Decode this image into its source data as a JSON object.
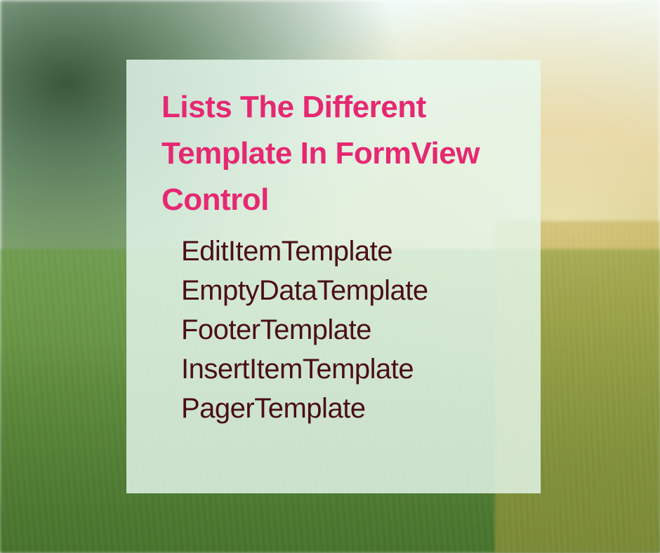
{
  "title": "Lists The Different Template In FormView Control",
  "items": [
    "EditItemTemplate",
    "EmptyDataTemplate",
    "FooterTemplate",
    "InsertItemTemplate",
    "PagerTemplate"
  ]
}
